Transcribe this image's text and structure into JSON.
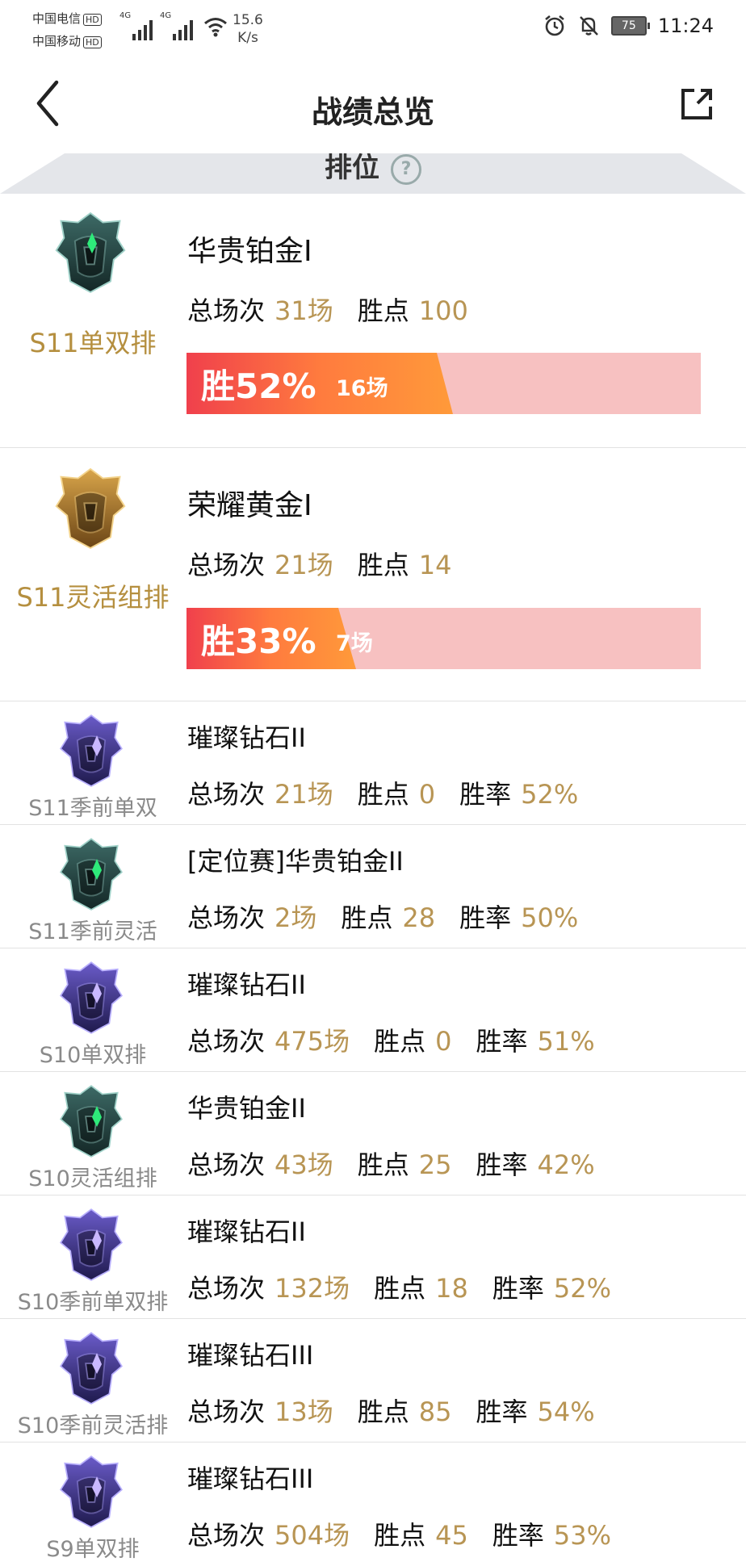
{
  "status_bar": {
    "carrier1": "中国电信",
    "carrier2": "中国移动",
    "hd": "HD",
    "net1": "4G",
    "net2": "4G",
    "speed_value": "15.6",
    "speed_unit": "K/s",
    "battery": "75",
    "time": "11:24"
  },
  "header": {
    "title": "战绩总览",
    "tab": "排位"
  },
  "featured": [
    {
      "queue": "S11单双排",
      "rank": "华贵铂金I",
      "games_label": "总场次",
      "games": "31场",
      "lp_label": "胜点",
      "lp": "100",
      "win_text": "胜52%",
      "wins": "16场",
      "win_rate": 52,
      "emblem": "platinum-emblem-icon"
    },
    {
      "queue": "S11灵活组排",
      "rank": "荣耀黄金I",
      "games_label": "总场次",
      "games": "21场",
      "lp_label": "胜点",
      "lp": "14",
      "win_text": "胜33%",
      "wins": "7场",
      "win_rate": 33,
      "emblem": "gold-emblem-icon"
    }
  ],
  "rows": [
    {
      "queue": "S11季前单双",
      "rank": "璀璨钻石II",
      "games_label": "总场次",
      "games": "21场",
      "lp_label": "胜点",
      "lp": "0",
      "wr_label": "胜率",
      "wr": "52%",
      "emblem": "diamond-emblem-icon"
    },
    {
      "queue": "S11季前灵活",
      "rank": "[定位赛]华贵铂金II",
      "games_label": "总场次",
      "games": "2场",
      "lp_label": "胜点",
      "lp": "28",
      "wr_label": "胜率",
      "wr": "50%",
      "emblem": "platinum-emblem-icon"
    },
    {
      "queue": "S10单双排",
      "rank": "璀璨钻石II",
      "games_label": "总场次",
      "games": "475场",
      "lp_label": "胜点",
      "lp": "0",
      "wr_label": "胜率",
      "wr": "51%",
      "emblem": "diamond-emblem-icon"
    },
    {
      "queue": "S10灵活组排",
      "rank": "华贵铂金II",
      "games_label": "总场次",
      "games": "43场",
      "lp_label": "胜点",
      "lp": "25",
      "wr_label": "胜率",
      "wr": "42%",
      "emblem": "platinum-emblem-icon"
    },
    {
      "queue": "S10季前单双排",
      "rank": "璀璨钻石II",
      "games_label": "总场次",
      "games": "132场",
      "lp_label": "胜点",
      "lp": "18",
      "wr_label": "胜率",
      "wr": "52%",
      "emblem": "diamond-emblem-icon"
    },
    {
      "queue": "S10季前灵活排",
      "rank": "璀璨钻石III",
      "games_label": "总场次",
      "games": "13场",
      "lp_label": "胜点",
      "lp": "85",
      "wr_label": "胜率",
      "wr": "54%",
      "emblem": "diamond-emblem-icon"
    },
    {
      "queue": "S9单双排",
      "rank": "璀璨钻石III",
      "games_label": "总场次",
      "games": "504场",
      "lp_label": "胜点",
      "lp": "45",
      "wr_label": "胜率",
      "wr": "53%",
      "emblem": "diamond-emblem-icon"
    }
  ],
  "colors": {
    "accent_gold": "#b89554",
    "win_bar_start": "#f0404c",
    "win_bar_end": "#ff9a3a",
    "win_bar_bg": "#f7c1c1"
  }
}
